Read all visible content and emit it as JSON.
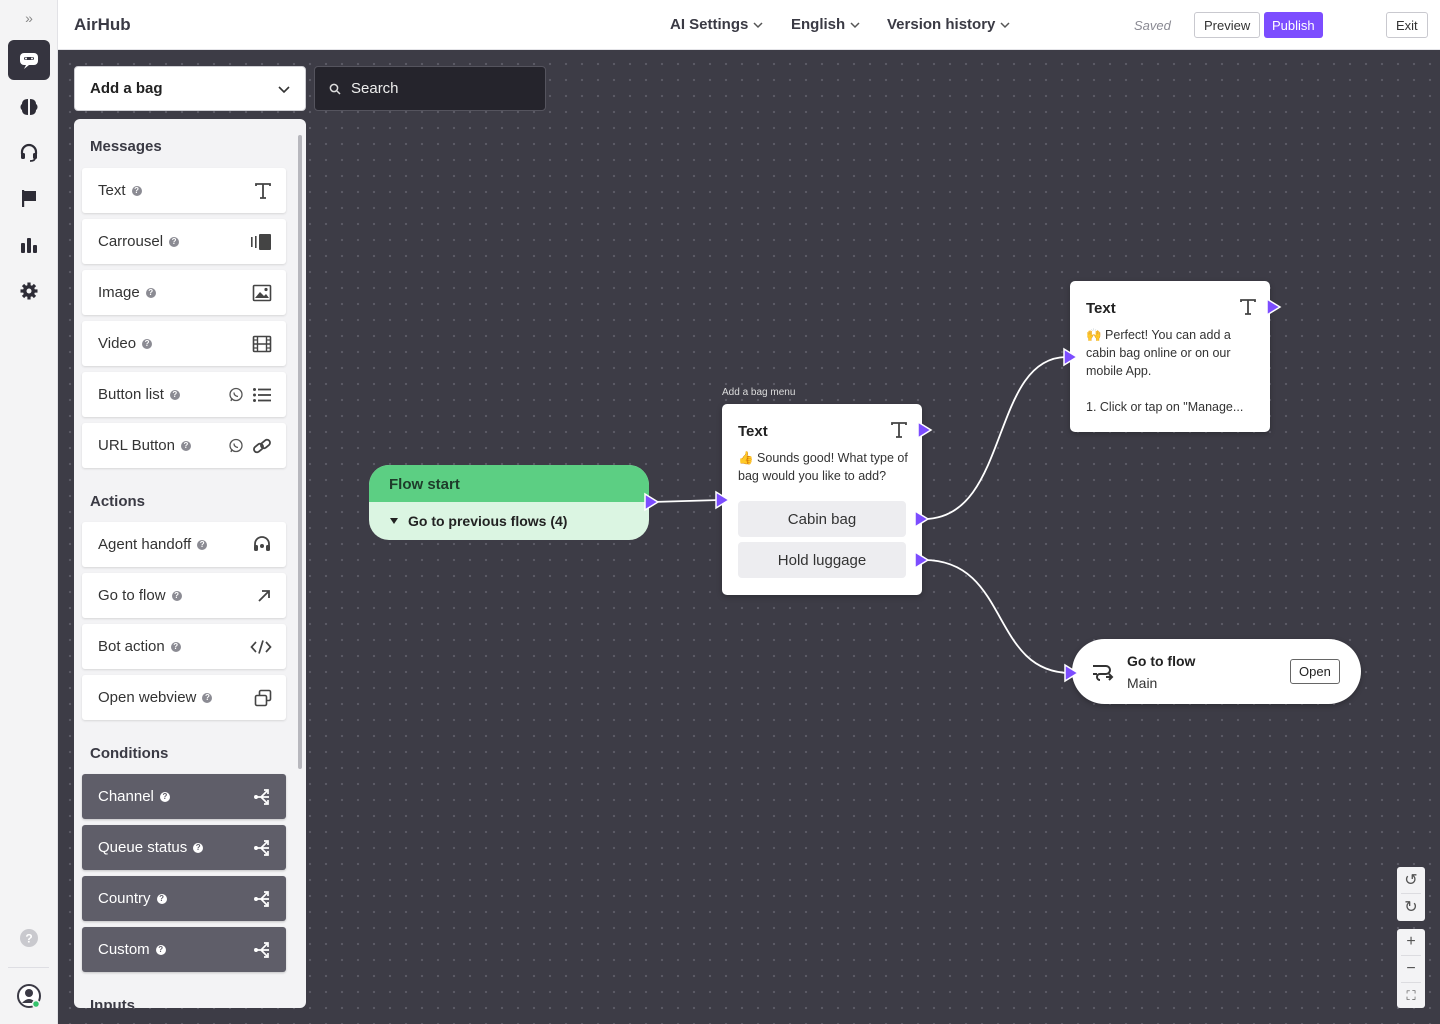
{
  "app": {
    "title": "AirHub",
    "expand_glyph": "»"
  },
  "rail": {
    "items": [
      {
        "name": "bot-icon",
        "active": true
      },
      {
        "name": "brain-icon"
      },
      {
        "name": "headset-icon"
      },
      {
        "name": "flag-icon"
      },
      {
        "name": "analytics-icon"
      },
      {
        "name": "settings-icon"
      }
    ]
  },
  "topbar": {
    "menus": [
      "AI Settings",
      "English",
      "Version history"
    ],
    "saved": "Saved",
    "preview": "Preview",
    "publish": "Publish",
    "exit": "Exit",
    "accent": "#7c4dff"
  },
  "toolbar": {
    "flow_select": "Add a bag",
    "search_placeholder": "Search"
  },
  "palette": {
    "help_glyph": "?",
    "sections": {
      "messages": "Messages",
      "actions": "Actions",
      "conditions": "Conditions",
      "inputs": "Inputs"
    },
    "messages": [
      {
        "label": "Text",
        "icon": "text-icon"
      },
      {
        "label": "Carrousel",
        "icon": "carousel-icon"
      },
      {
        "label": "Image",
        "icon": "image-icon"
      },
      {
        "label": "Video",
        "icon": "video-icon"
      },
      {
        "label": "Button list",
        "icon": "list-icon"
      },
      {
        "label": "URL Button",
        "icon": "link-icon"
      }
    ],
    "actions": [
      {
        "label": "Agent handoff",
        "icon": "headset-icon"
      },
      {
        "label": "Go to flow",
        "icon": "arrow-up-right-icon"
      },
      {
        "label": "Bot action",
        "icon": "code-icon"
      },
      {
        "label": "Open webview",
        "icon": "webview-icon"
      }
    ],
    "conditions": [
      {
        "label": "Channel",
        "icon": "branch-icon"
      },
      {
        "label": "Queue status",
        "icon": "branch-icon"
      },
      {
        "label": "Country",
        "icon": "branch-icon"
      },
      {
        "label": "Custom",
        "icon": "branch-icon"
      }
    ]
  },
  "canvas": {
    "flow_start": {
      "title": "Flow start",
      "previous": "Go to previous flows (4)",
      "color": "#5ccf83"
    },
    "menu_node": {
      "label": "Add a bag menu",
      "title": "Text",
      "text": "👍 Sounds good! What type of bag would you like to add?",
      "buttons": [
        "Cabin bag",
        "Hold luggage"
      ]
    },
    "text_node": {
      "title": "Text",
      "line1": "🙌 Perfect! You can add a cabin bag online or on our mobile App.",
      "line2": "1. Click or tap on \"Manage..."
    },
    "goto_node": {
      "title": "Go to flow",
      "target": "Main",
      "open": "Open"
    },
    "port_color": "#7c4dff"
  },
  "zoom": {
    "undo": "↺",
    "redo": "↻",
    "zoom_in": "+",
    "zoom_out": "−",
    "fit": "⛶"
  }
}
